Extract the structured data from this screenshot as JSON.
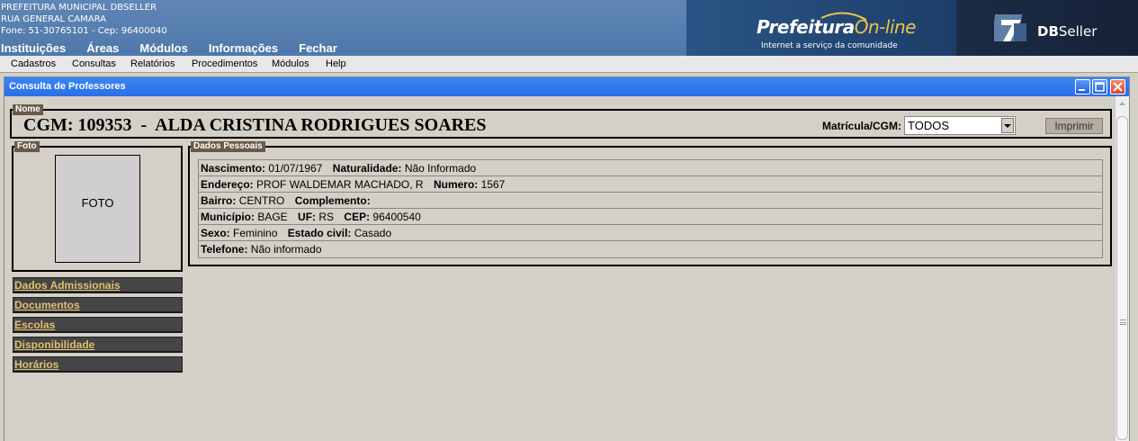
{
  "header": {
    "org_name": "PREFEITURA MUNICIPAL DBSELLER",
    "org_address": "RUA GENERAL CAMARA",
    "org_contact": "Fone: 51-30765101  -  Cep: 96400040",
    "logo_prefeitura": "Prefeitura",
    "logo_online": "On-line",
    "logo_tagline": "Internet a serviço da comunidade",
    "logo_db": "DB",
    "logo_seller": "Seller",
    "main_menu": [
      "Instituições",
      "Áreas",
      "Módulos",
      "Informações",
      "Fechar"
    ]
  },
  "sub_menu": [
    "Cadastros",
    "Consultas",
    "Relatórios",
    "Procedimentos",
    "Módulos",
    "Help"
  ],
  "window": {
    "title": "Consulta de Professores",
    "buttons": [
      "minimize-icon",
      "maximize-icon",
      "close-icon"
    ]
  },
  "nome": {
    "legend": "Nome",
    "cgm_label": "CGM:",
    "cgm_number": "109353",
    "separator": "-",
    "name": "ALDA CRISTINA RODRIGUES SOARES",
    "matricula_label": "Matrícula/CGM:",
    "matricula_value": "TODOS",
    "imprimir_label": "Imprimir"
  },
  "foto": {
    "legend": "Foto",
    "placeholder": "FOTO"
  },
  "dados_pessoais": {
    "legend": "Dados Pessoais",
    "nascimento_label": "Nascimento:",
    "nascimento": "01/07/1967",
    "naturalidade_label": "Naturalidade:",
    "naturalidade": "Não Informado",
    "endereco_label": "Endereço:",
    "endereco": "PROF WALDEMAR MACHADO, R",
    "numero_label": "Numero:",
    "numero": "1567",
    "bairro_label": "Bairro:",
    "bairro": "CENTRO",
    "complemento_label": "Complemento:",
    "complemento": "",
    "municipio_label": "Município:",
    "municipio": "BAGE",
    "uf_label": "UF:",
    "uf": "RS",
    "cep_label": "CEP:",
    "cep": "96400540",
    "sexo_label": "Sexo:",
    "sexo": "Feminino",
    "estado_civil_label": "Estado civil:",
    "estado_civil": "Casado",
    "telefone_label": "Telefone:",
    "telefone": "Não informado"
  },
  "nav_links": [
    "Dados Admissionais",
    "Documentos",
    "Escolas",
    "Disponibilidade",
    "Horários"
  ],
  "colors": {
    "banner": "#5f86b6",
    "titlebar": "#2a6ee6",
    "legend_bg": "#6b5a48",
    "nav_bg": "#454545",
    "nav_link": "#e0c070"
  }
}
